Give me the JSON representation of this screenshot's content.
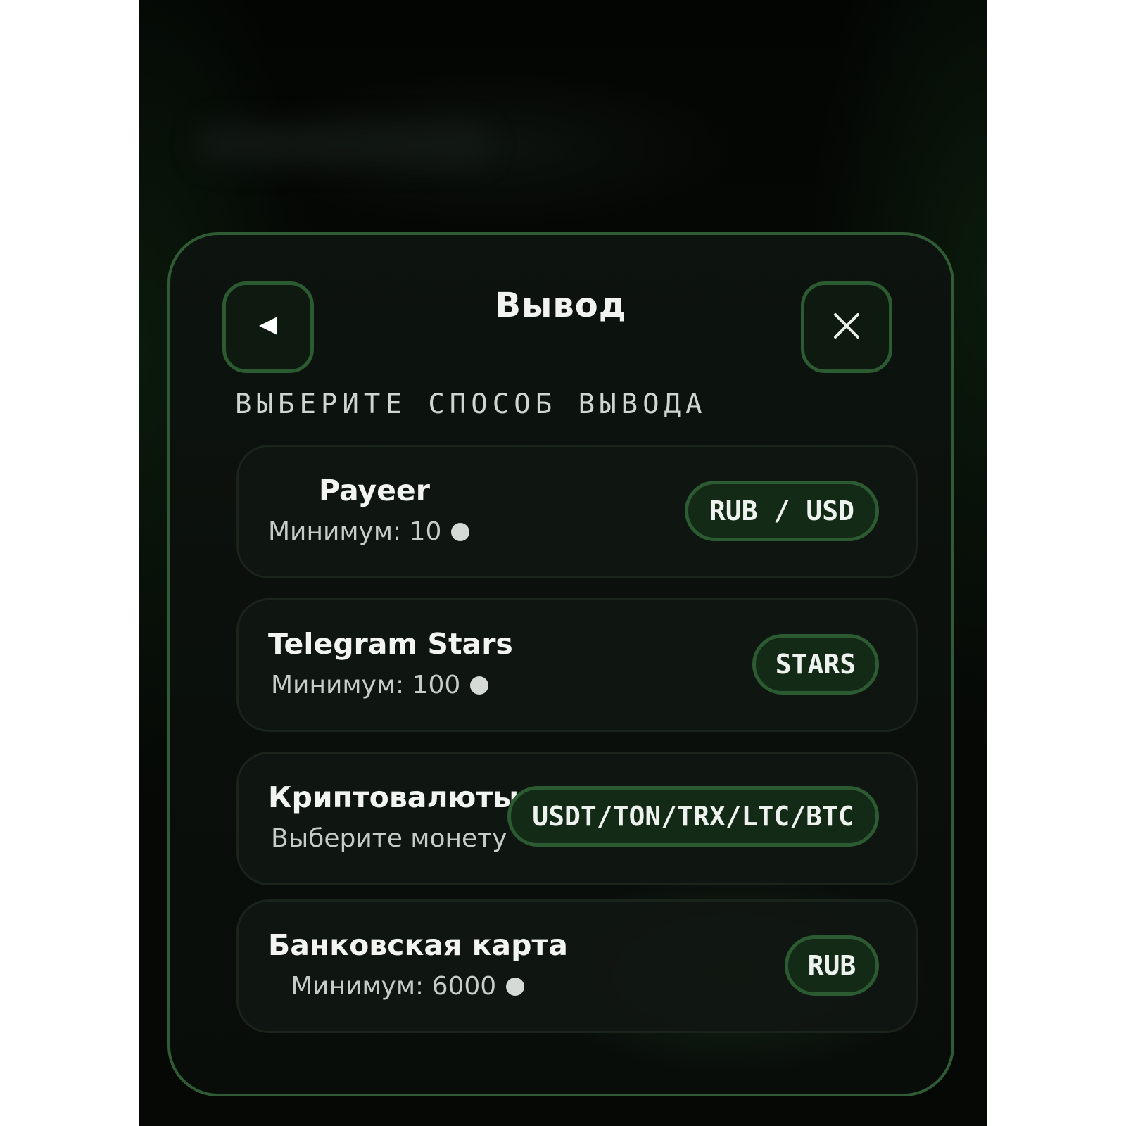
{
  "header": {
    "title": "Вывод",
    "back_icon": "back-triangle-icon",
    "close_icon": "close-icon"
  },
  "subtitle": "ВЫБЕРИТЕ СПОСОБ ВЫВОДА",
  "methods": [
    {
      "name": "Payeer",
      "detail": "Минимум: 10",
      "show_coin": true,
      "badge": "RUB / USD"
    },
    {
      "name": "Telegram Stars",
      "detail": "Минимум: 100",
      "show_coin": true,
      "badge": "STARS"
    },
    {
      "name": "Криптовалюты",
      "detail": "Выберите монету",
      "show_coin": false,
      "badge": "USDT/TON/TRX/LTC/BTC"
    },
    {
      "name": "Банковская карта",
      "detail": "Минимум: 6000",
      "show_coin": true,
      "badge": "RUB"
    }
  ],
  "colors": {
    "accent_border": "#2c5a31",
    "background": "#050805",
    "card_background": "#101611",
    "text": "#f1f4f1"
  }
}
